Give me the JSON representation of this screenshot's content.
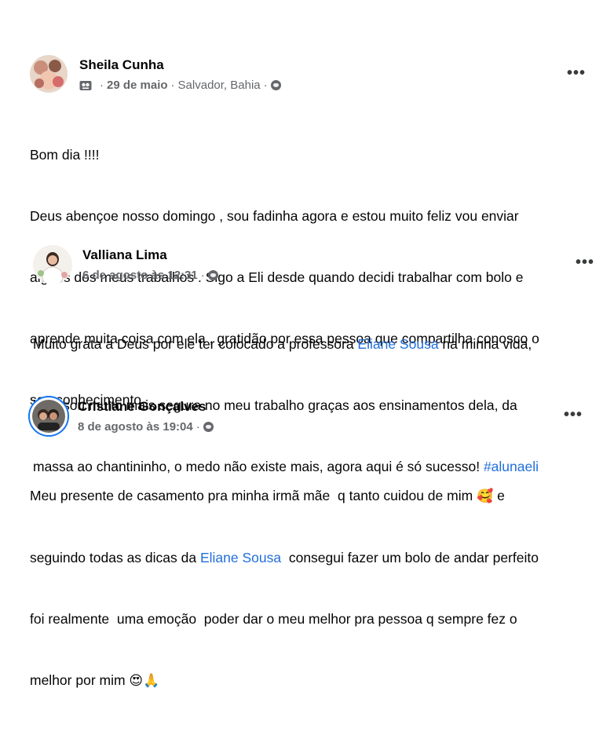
{
  "posts": [
    {
      "author": "Sheila Cunha",
      "date": "29 de maio",
      "location": "Salvador, Bahia",
      "privacy_icon": "globe-icon",
      "more_icon": "more-options-icon",
      "text_lines": [
        "Bom dia !!!!",
        "Deus abençoe nosso domingo , sou fadinha agora e estou muito feliz vou enviar",
        "alguns dos meus trabalhos . Sigo a Eli desde quando decidi trabalhar com bolo e",
        "aprende muita coisa com ela , gratidão por essa pessoa que compartilha conosco o",
        "seu conhecimento ."
      ]
    },
    {
      "author": "Valliana Lima",
      "date": "6 de agosto às 12:31",
      "privacy_icon": "globe-icon",
      "more_icon": "more-options-icon",
      "line1_before": "Muito grata a Deus por ele ter colocado a professora ",
      "line1_mention": "Eliane Sousa",
      "line1_after": " na minha vida,",
      "line2": "hoje sou muito mais segura no meu trabalho graças aos ensinamentos dela, da",
      "line3_before": "massa ao chantininho, o medo não existe mais, agora aqui é só sucesso! ",
      "line3_hashtag": "#alunaeli"
    },
    {
      "author": "Cristiane Gonçalves",
      "date": "8 de agosto às 19:04",
      "privacy_icon": "globe-icon",
      "more_icon": "more-options-icon",
      "line1_before": "Meu presente de casamento pra minha irmã mãe  q tanto cuidou de mim ",
      "line1_emoji": "🥰",
      "line1_after": " e",
      "line2_before": "seguindo todas as dicas da ",
      "line2_mention": "Eliane Sousa",
      "line2_after": "  consegui fazer um bolo de andar perfeito",
      "line3": "foi realmente  uma emoção  poder dar o meu melhor pra pessoa q sempre fez o",
      "line4_before": "melhor por mim ",
      "line4_emoji": "😍🙏"
    }
  ],
  "separator": "·",
  "more_label": "•••"
}
